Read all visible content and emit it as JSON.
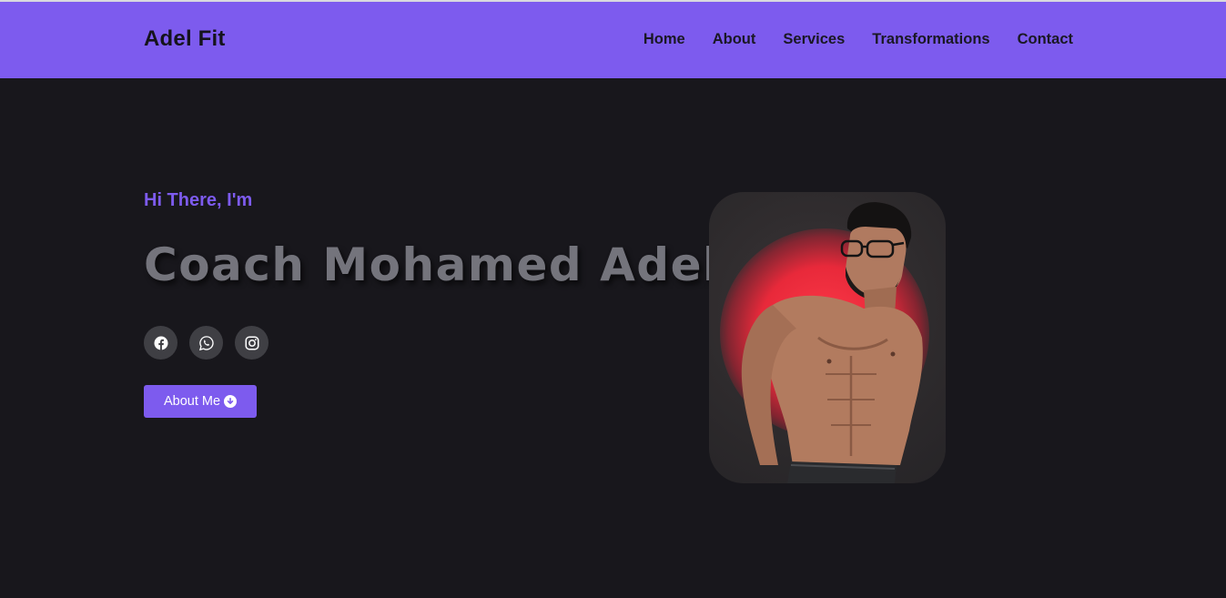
{
  "header": {
    "logo": "Adel Fit",
    "nav": [
      "Home",
      "About",
      "Services",
      "Transformations",
      "Contact"
    ]
  },
  "hero": {
    "greeting": "Hi There, I'm",
    "name": "Coach Mohamed Adel",
    "socials": [
      "facebook-icon",
      "whatsapp-icon",
      "instagram-icon"
    ],
    "button_label": "About Me",
    "button_icon": "arrow-down-circle-icon",
    "photo_alt": "coach-photo"
  },
  "colors": {
    "accent": "#7d5bee",
    "background": "#18171c",
    "name_text": "#74747c",
    "social_bg": "#3f3f44"
  }
}
